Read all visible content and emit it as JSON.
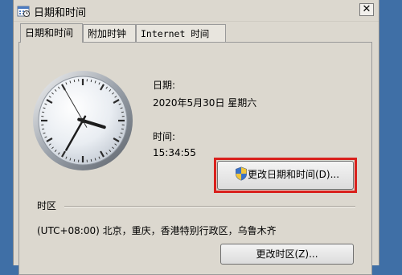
{
  "window": {
    "title": "日期和时间",
    "close_glyph": "✕"
  },
  "tabs": [
    {
      "label": "日期和时间"
    },
    {
      "label": "附加时钟"
    },
    {
      "label": "Internet 时间"
    }
  ],
  "date": {
    "label": "日期:",
    "value": "2020年5月30日 星期六"
  },
  "time": {
    "label": "时间:",
    "value": "15:34:55"
  },
  "change_datetime_button": "更改日期和时间(D)...",
  "timezone": {
    "section_label": "时区",
    "value": "(UTC+08:00) 北京，重庆，香港特别行政区，乌鲁木齐",
    "change_button": "更改时区(Z)..."
  },
  "clock_time": {
    "hours": 15,
    "minutes": 34,
    "seconds": 55
  },
  "colors": {
    "highlight_border": "#d9201c",
    "dialog_bg": "#dcd8cf",
    "desktop_bg": "#3f6fa6"
  },
  "icons": [
    "date-time-app-icon",
    "close-icon",
    "uac-shield-icon",
    "analog-clock"
  ]
}
